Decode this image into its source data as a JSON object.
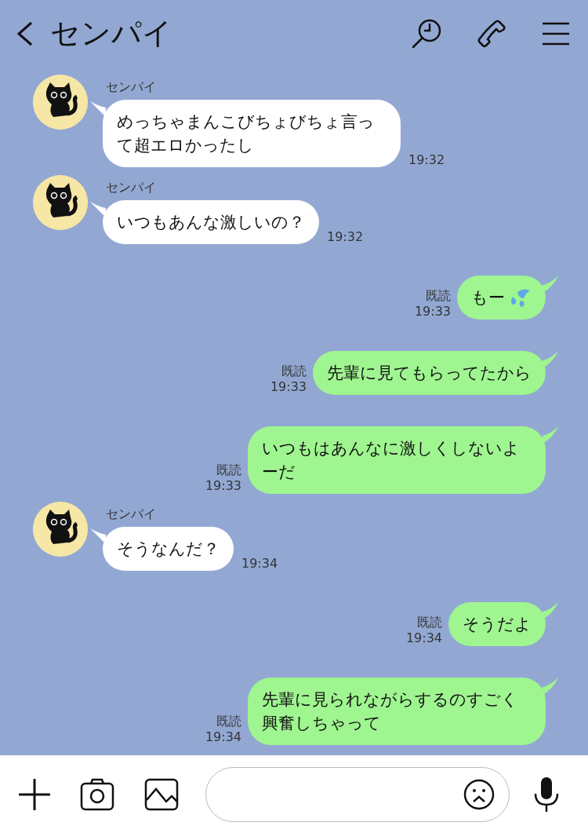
{
  "header": {
    "title": "センパイ"
  },
  "messages": [
    {
      "kind": "incoming",
      "sender": "センパイ",
      "text": "めっちゃまんこびちょびちょ言って超エロかったし",
      "time": "19:32"
    },
    {
      "kind": "incoming",
      "sender": "センパイ",
      "text": "いつもあんな激しいの？",
      "time": "19:32"
    },
    {
      "kind": "emoji",
      "text": "もー",
      "read": "既読",
      "time": "19:33"
    },
    {
      "kind": "outgoing",
      "text": "先輩に見てもらってたから",
      "read": "既読",
      "time": "19:33"
    },
    {
      "kind": "outgoing",
      "text": "いつもはあんなに激しくしないよーだ",
      "read": "既読",
      "time": "19:33"
    },
    {
      "kind": "incoming",
      "sender": "センパイ",
      "text": "そうなんだ？",
      "time": "19:34"
    },
    {
      "kind": "outgoing",
      "text": "そうだよ",
      "read": "既読",
      "time": "19:34"
    },
    {
      "kind": "outgoing",
      "text": "先輩に見られながらするのすごく興奮しちゃって",
      "read": "既読",
      "time": "19:34"
    }
  ]
}
